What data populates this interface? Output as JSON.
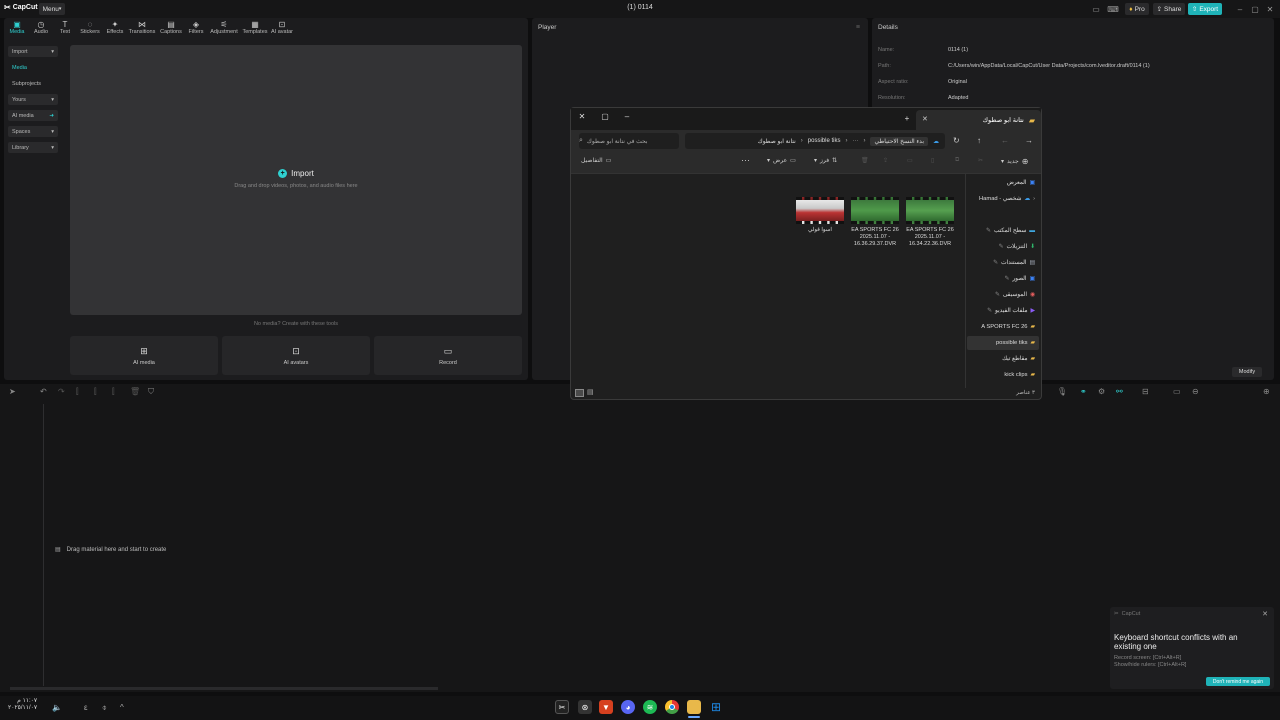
{
  "app": {
    "logo_text": "CapCut",
    "menu_label": "Menu",
    "project_title": "(1) 0114",
    "pro_label": "Pro",
    "share_label": "Share",
    "export_label": "Export",
    "accent": "#2fd0d0"
  },
  "toolbar": {
    "tools": [
      {
        "label": "Media",
        "icon": "media-icon"
      },
      {
        "label": "Audio",
        "icon": "audio-icon"
      },
      {
        "label": "Text",
        "icon": "text-icon"
      },
      {
        "label": "Stickers",
        "icon": "stickers-icon"
      },
      {
        "label": "Effects",
        "icon": "effects-icon"
      },
      {
        "label": "Transitions",
        "icon": "transitions-icon"
      },
      {
        "label": "Captions",
        "icon": "captions-icon"
      },
      {
        "label": "Filters",
        "icon": "filters-icon"
      },
      {
        "label": "Adjustment",
        "icon": "adjustment-icon"
      },
      {
        "label": "Templates",
        "icon": "templates-icon"
      },
      {
        "label": "AI avatar",
        "icon": "ai-avatar-icon"
      }
    ]
  },
  "sidebar": {
    "items": [
      {
        "label": "Import"
      },
      {
        "label": "Media"
      },
      {
        "label": "Subprojects"
      },
      {
        "label": "Yours"
      },
      {
        "label": "AI media"
      },
      {
        "label": "Spaces"
      },
      {
        "label": "Library"
      }
    ]
  },
  "media": {
    "import_label": "Import",
    "import_hint": "Drag and drop videos, photos, and audio files here",
    "no_media": "No media? Create with these tools",
    "cards": [
      {
        "label": "AI media"
      },
      {
        "label": "AI avatars"
      },
      {
        "label": "Record"
      }
    ]
  },
  "player": {
    "title": "Player"
  },
  "details": {
    "title": "Details",
    "rows": [
      {
        "label": "Name:",
        "value": "0114 (1)"
      },
      {
        "label": "Path:",
        "value": "C:/Users/win/AppData/Local/CapCut/User Data/Projects/com.lveditor.draft/0114 (1)"
      },
      {
        "label": "Aspect ratio:",
        "value": "Original"
      },
      {
        "label": "Resolution:",
        "value": "Adapted"
      }
    ],
    "modify_label": "Modify"
  },
  "timeline": {
    "drag_hint": "Drag material here and start to create"
  },
  "explorer": {
    "tab_title": "نتانة ابو صطوك",
    "search_placeholder": "بحث في نتانة ابو صطوك",
    "breadcrumb": [
      "بدء النسخ الاحتياطي",
      "possible tiks",
      "نتانة ابو صطوك"
    ],
    "new_label": "جديد",
    "sort_label": "فرز",
    "view_label": "عرض",
    "details_label": "التفاصيل",
    "nav_items": [
      {
        "label": "المعرض",
        "color": "#3b82f6"
      },
      {
        "label": "Hamad - شخصي",
        "color": "#3b9be8"
      },
      {
        "label": "سطح المكتب",
        "color": "#3fa7e0"
      },
      {
        "label": "التنزيلات",
        "color": "#2fb56a"
      },
      {
        "label": "المستندات",
        "color": "#9ca3af"
      },
      {
        "label": "الصور",
        "color": "#3b82f6"
      },
      {
        "label": "الموسيقى",
        "color": "#e25c5c"
      },
      {
        "label": "ملفات الفيديو",
        "color": "#8b5cf6"
      },
      {
        "label": "A SPORTS FC 26",
        "color": "#e8b84a"
      },
      {
        "label": "possible tiks",
        "color": "#e8b84a"
      },
      {
        "label": "مقاطع تيك",
        "color": "#e8b84a"
      },
      {
        "label": "kick clips",
        "color": "#e8b84a"
      }
    ],
    "files": [
      {
        "name": "اسوا قولي"
      },
      {
        "name": "EA SPORTS FC 26 2025.11.07 - 16.36.29.37.DVR"
      },
      {
        "name": "EA SPORTS FC 26 2025.11.07 - 16.34.22.36.DVR"
      }
    ],
    "status": "٣ عناصر"
  },
  "notification": {
    "source": "CapCut",
    "title": "Keyboard shortcut conflicts with an existing one",
    "line1": "Record screen: [Ctrl+Alt+R]",
    "line2": "Show/hide rulers: [Ctrl+Alt+R]",
    "button": "Don't remind me again"
  },
  "taskbar": {
    "clock_time": "١١:٠٧ م",
    "clock_date": "٢٠٢٥/١١/٠٧",
    "apps": [
      {
        "name": "capcut",
        "color": "#222"
      },
      {
        "name": "chatgpt",
        "color": "#333"
      },
      {
        "name": "brave",
        "color": "#d6401f"
      },
      {
        "name": "discord",
        "color": "#5865f2"
      },
      {
        "name": "spotify",
        "color": "#1db954"
      },
      {
        "name": "chrome",
        "color": "#e7b416"
      },
      {
        "name": "explorer",
        "color": "#e8b84a"
      },
      {
        "name": "windows",
        "color": "#1e88e5"
      }
    ]
  }
}
